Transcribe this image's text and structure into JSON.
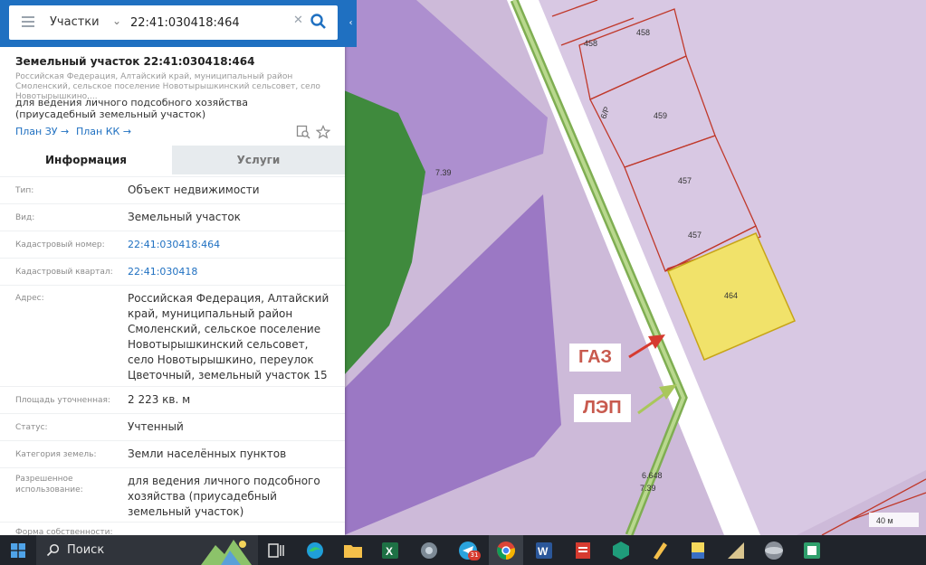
{
  "search": {
    "layer": "Участки",
    "query": "22:41:030418:464"
  },
  "card": {
    "title": "Земельный участок 22:41:030418:464",
    "address_short": "Российская Федерация, Алтайский край, муниципальный район Смоленский, сельское поселение Новотырышкинский сельсовет, село Новотырышкино,...",
    "usage": "для ведения личного подсобного хозяйства (приусадебный земельный участок)",
    "link_plan_zu": "План ЗУ →",
    "link_plan_kk": "План КК →"
  },
  "tabs": [
    "Информация",
    "Услуги"
  ],
  "info": [
    {
      "label": "Тип:",
      "value": "Объект недвижимости"
    },
    {
      "label": "Вид:",
      "value": "Земельный участок"
    },
    {
      "label": "Кадастровый номер:",
      "value": "22:41:030418:464"
    },
    {
      "label": "Кадастровый квартал:",
      "value": "22:41:030418"
    },
    {
      "label": "Адрес:",
      "value": "Российская Федерация, Алтайский край, муниципальный район Смоленский, сельское поселение Новотырышкинский сельсовет, село Новотырышкино, переулок Цветочный, земельный участок 15"
    },
    {
      "label": "Площадь уточненная:",
      "value": "2 223 кв. м"
    },
    {
      "label": "Статус:",
      "value": "Учтенный"
    },
    {
      "label": "Категория земель:",
      "value": "Земли населённых пунктов"
    },
    {
      "label": "Разрешенное использование:",
      "value": "для ведения личного подсобного хозяйства (приусадебный земельный участок)"
    },
    {
      "label": "Форма собственности:",
      "value": ""
    }
  ],
  "map": {
    "parcel_labels": [
      "458",
      "458",
      "459",
      "457",
      "457",
      "464"
    ],
    "rotated_label": "6/P",
    "zone_labels": [
      "7.39",
      "6.648",
      "7.39"
    ],
    "callout_gas": "ГАЗ",
    "callout_power": "ЛЭП",
    "scale": "40 м",
    "colors": {
      "gas_arrow": "#d63b30",
      "power_arrow": "#a9c75b",
      "selected_parcel": "#f1e26a",
      "parcel_border": "#c0392b"
    }
  },
  "taskbar": {
    "search_label": "Поиск",
    "badge": "31"
  }
}
